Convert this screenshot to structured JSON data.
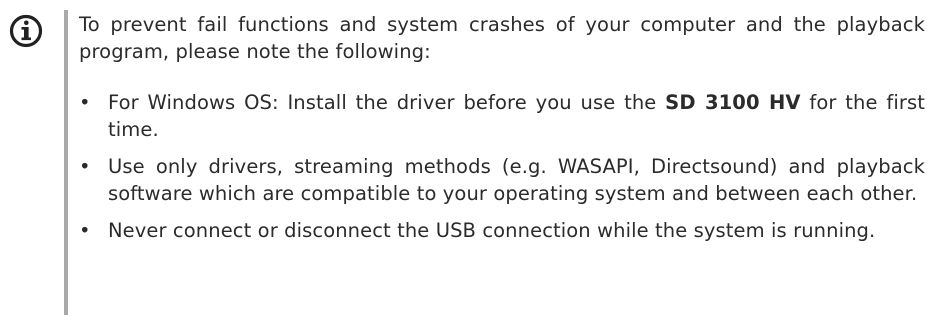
{
  "icon": "info-icon",
  "colors": {
    "text": "#2b2b2b",
    "bar": "#a9a9a9",
    "icon": "#222222"
  },
  "notice": {
    "intro": "To prevent fail functions and system crashes of your computer and the playback program, please note the following:",
    "bullet_symbol": "•",
    "items": [
      {
        "before": "For Windows OS: Install the driver before you use the ",
        "bold": "SD 3100 HV",
        "after": " for the first time."
      },
      {
        "text": "Use only drivers, streaming methods (e.g. WASAPI, Directsound) and playback software which are compatible to your operating system and between each other."
      },
      {
        "text": "Never connect or disconnect the USB connection while the system is running."
      }
    ]
  }
}
